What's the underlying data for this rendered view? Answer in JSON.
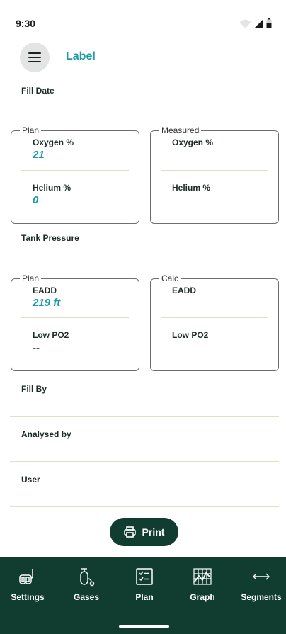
{
  "status_bar": {
    "time": "9:30"
  },
  "header": {
    "title": "Label"
  },
  "fields": {
    "fill_date": "Fill Date",
    "tank_pressure": "Tank Pressure",
    "fill_by": "Fill By",
    "analysed_by": "Analysed by",
    "user": "User"
  },
  "gas_plan": {
    "legend": "Plan",
    "oxygen_label": "Oxygen %",
    "oxygen_value": "21",
    "helium_label": "Helium %",
    "helium_value": "0"
  },
  "gas_measured": {
    "legend": "Measured",
    "oxygen_label": "Oxygen %",
    "helium_label": "Helium %"
  },
  "depth_plan": {
    "legend": "Plan",
    "eadd_label": "EADD",
    "eadd_value": "219 ft",
    "low_po2_label": "Low PO2",
    "low_po2_value": "--"
  },
  "depth_calc": {
    "legend": "Calc",
    "eadd_label": "EADD",
    "low_po2_label": "Low PO2"
  },
  "print_button": {
    "label": "Print"
  },
  "bottom_nav": {
    "items": [
      {
        "label": "Settings",
        "icon": "snorkel-mask-icon"
      },
      {
        "label": "Gases",
        "icon": "gas-tank-icon"
      },
      {
        "label": "Plan",
        "icon": "checklist-icon"
      },
      {
        "label": "Graph",
        "icon": "graph-icon"
      },
      {
        "label": "Segments",
        "icon": "double-arrow-icon"
      }
    ]
  },
  "colors": {
    "accent": "#1b9aaa",
    "nav_background": "#113d30",
    "divider": "#dfe1c6"
  }
}
